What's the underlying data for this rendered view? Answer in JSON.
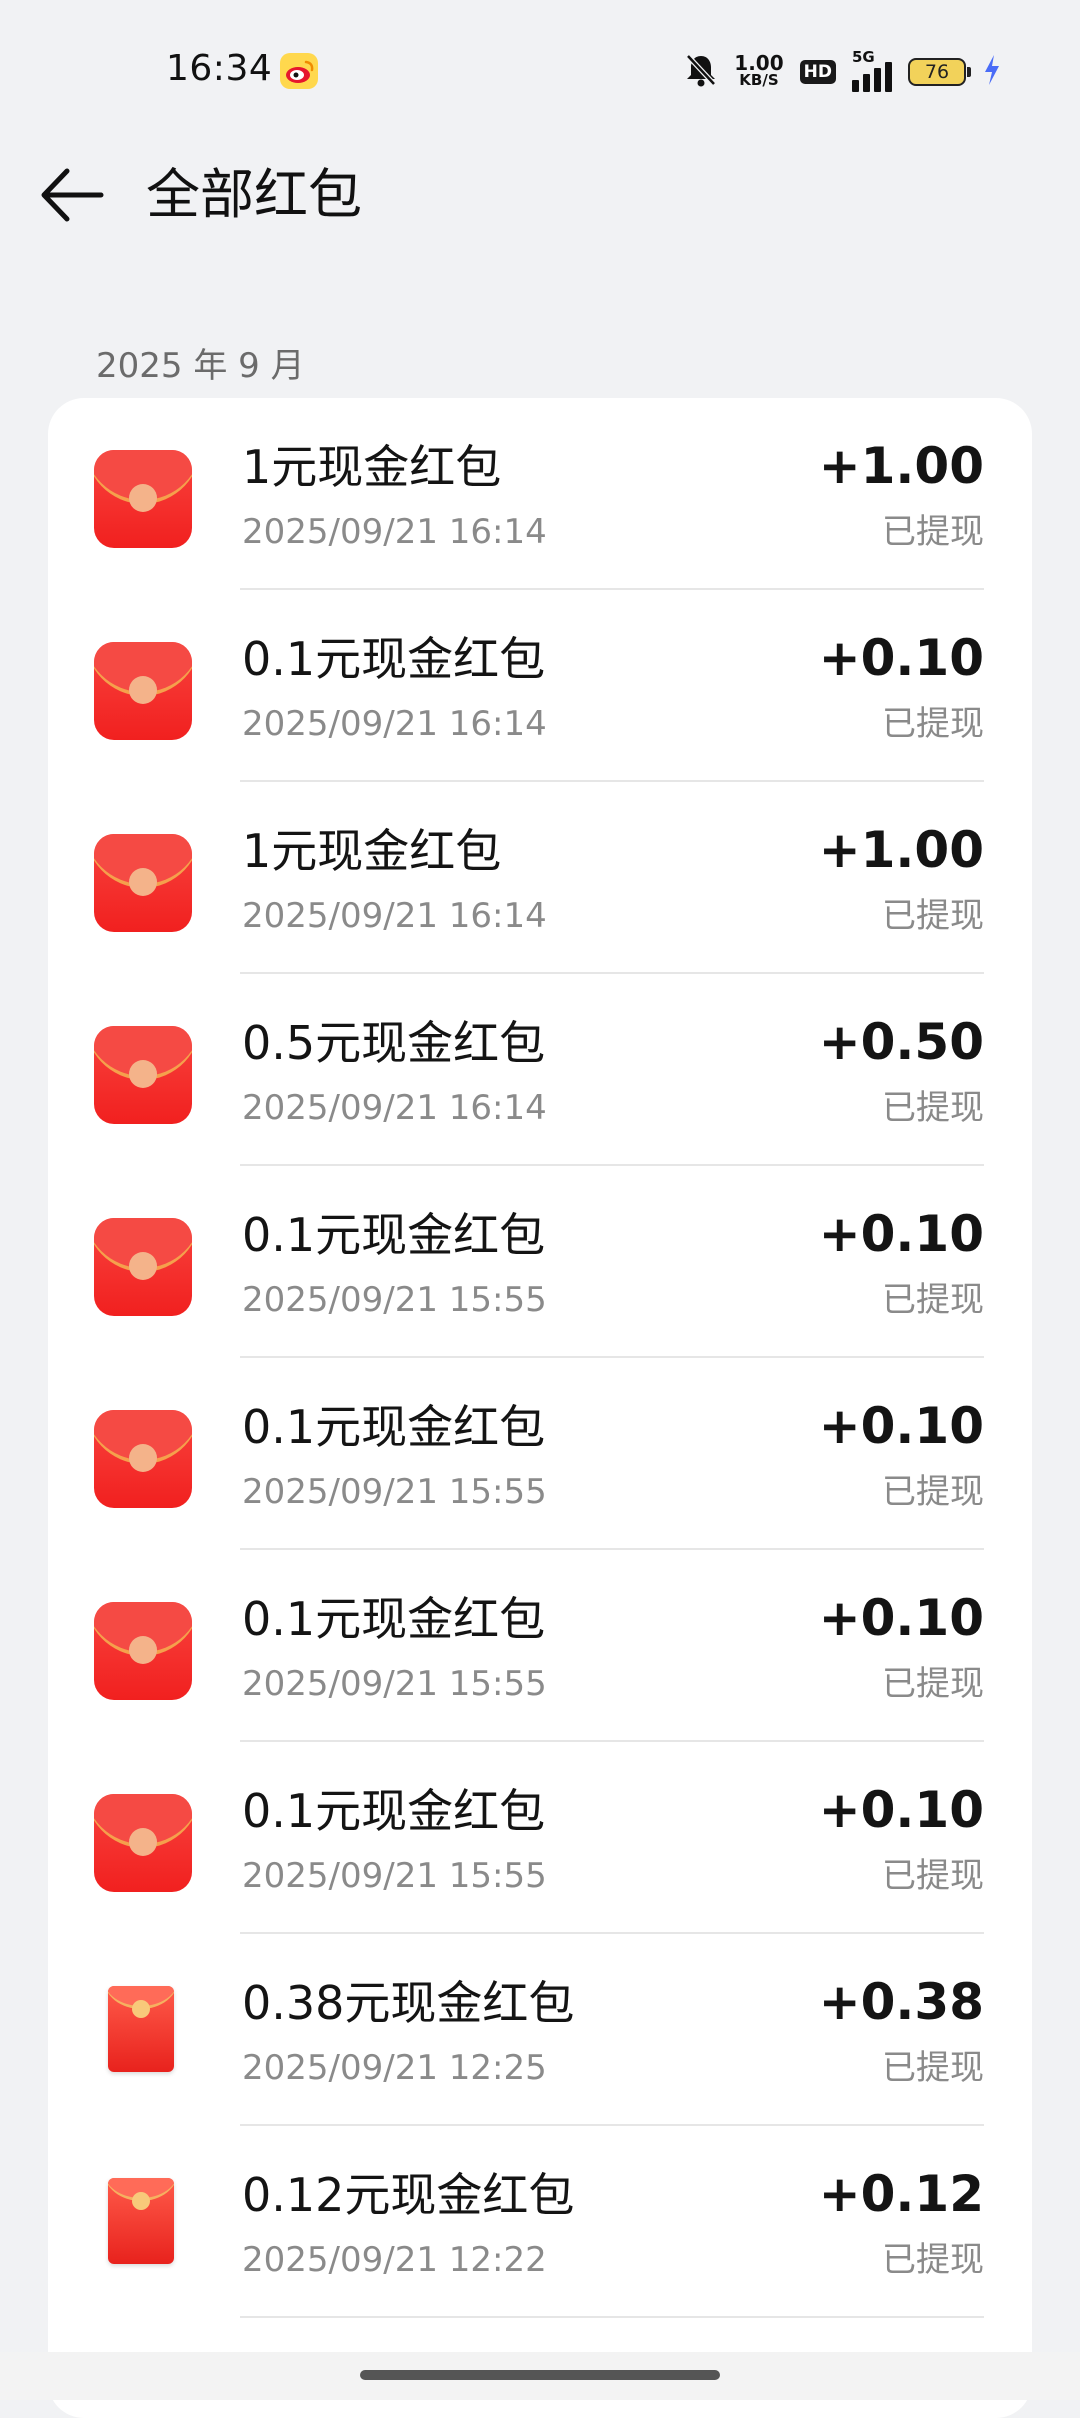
{
  "status_bar": {
    "time": "16:34",
    "net_speed_value": "1.00",
    "net_speed_unit": "KB/S",
    "hd": "HD",
    "network_type": "5G",
    "battery_level": "76"
  },
  "header": {
    "title": "全部红包"
  },
  "section": {
    "month_label": "2025 年 9 月"
  },
  "items": [
    {
      "title": "1元现金红包",
      "time": "2025/09/21 16:14",
      "amount": "+1.00",
      "status": "已提现"
    },
    {
      "title": "0.1元现金红包",
      "time": "2025/09/21 16:14",
      "amount": "+0.10",
      "status": "已提现"
    },
    {
      "title": "1元现金红包",
      "time": "2025/09/21 16:14",
      "amount": "+1.00",
      "status": "已提现"
    },
    {
      "title": "0.5元现金红包",
      "time": "2025/09/21 16:14",
      "amount": "+0.50",
      "status": "已提现"
    },
    {
      "title": "0.1元现金红包",
      "time": "2025/09/21 15:55",
      "amount": "+0.10",
      "status": "已提现"
    },
    {
      "title": "0.1元现金红包",
      "time": "2025/09/21 15:55",
      "amount": "+0.10",
      "status": "已提现"
    },
    {
      "title": "0.1元现金红包",
      "time": "2025/09/21 15:55",
      "amount": "+0.10",
      "status": "已提现"
    },
    {
      "title": "0.1元现金红包",
      "time": "2025/09/21 15:55",
      "amount": "+0.10",
      "status": "已提现"
    },
    {
      "title": "0.38元现金红包",
      "time": "2025/09/21 12:25",
      "amount": "+0.38",
      "status": "已提现"
    },
    {
      "title": "0.12元现金红包",
      "time": "2025/09/21 12:22",
      "amount": "+0.12",
      "status": "已提现"
    }
  ],
  "icons": {
    "back": "arrow-left-icon",
    "weibo": "weibo-icon",
    "mute": "bell-off-icon",
    "envelope": "red-envelope-icon"
  },
  "colors": {
    "background": "#f1f2f4",
    "card": "#ffffff",
    "envelope_red": "#f1201f",
    "text_primary": "#141414",
    "text_secondary": "#8a8a8a"
  }
}
